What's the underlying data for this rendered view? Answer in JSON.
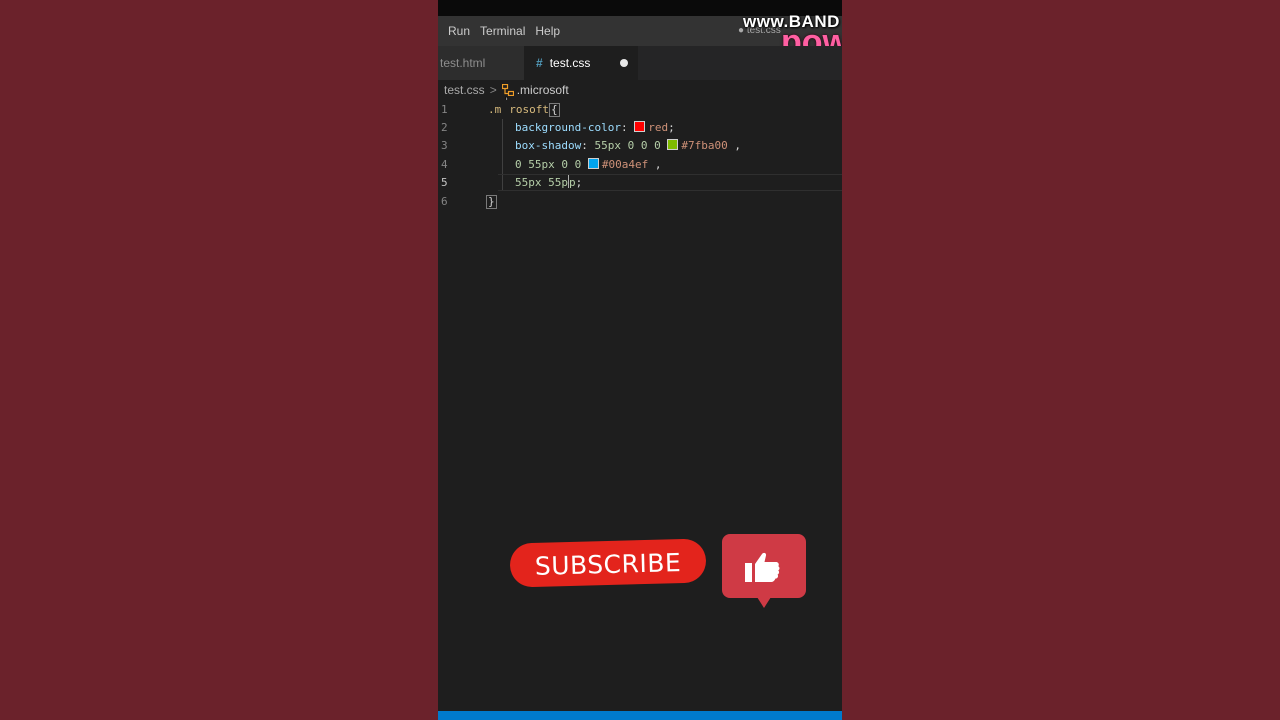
{
  "menubar": {
    "items": [
      "Run",
      "Terminal",
      "Help"
    ],
    "window_title": "● test.css"
  },
  "watermark": {
    "line1": "www.BAND",
    "line2": "pow"
  },
  "tabs": {
    "inactive_label": "test.html",
    "active_label": "test.css",
    "active_icon": "#"
  },
  "breadcrumb": {
    "file": "test.css",
    "separator": ">",
    "symbol": ".microsoft"
  },
  "editor": {
    "line_numbers": [
      "1",
      "2",
      "3",
      "4",
      "5",
      "6"
    ],
    "line1": {
      "selector_start": ".m",
      "selector_rest": "rosoft",
      "brace": "{"
    },
    "line2": {
      "property": "background-color",
      "colon": ":",
      "swatch_color": "#ff0000",
      "value": "red",
      "semicolon": ";"
    },
    "line3": {
      "property": "box-shadow",
      "colon": ":",
      "numbers": "55px 0 0 0",
      "swatch_color": "#7fba00",
      "value": "#7fba00",
      "comma": ","
    },
    "line4": {
      "numbers": "0 55px 0 0",
      "swatch_color": "#00a4ef",
      "value": "#00a4ef",
      "comma": ","
    },
    "line5": {
      "numbers": "55px 55p",
      "after_cursor": "p",
      "semicolon": ";"
    },
    "line6": {
      "brace": "}"
    }
  },
  "overlay": {
    "subscribe_label": "SUBSCRIBE",
    "subscribe_color": "#e3241c",
    "like_color": "#cf3a45"
  },
  "colors": {
    "page_background": "#6b222b",
    "editor_background": "#1e1e1e",
    "statusbar": "#007acc"
  }
}
